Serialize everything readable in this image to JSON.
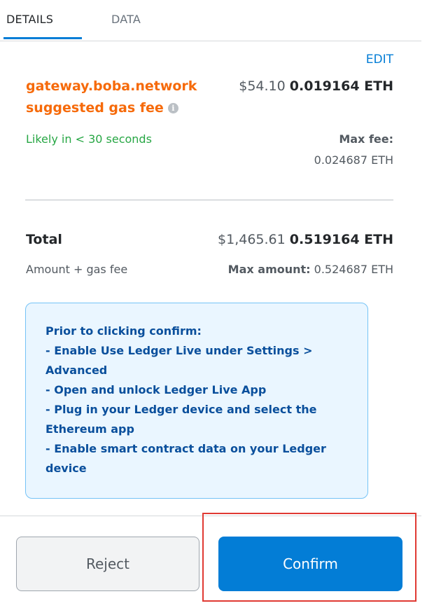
{
  "tabs": [
    {
      "label": "DETAILS",
      "active": true
    },
    {
      "label": "DATA",
      "active": false
    }
  ],
  "gas": {
    "edit_label": "EDIT",
    "site_line1": "gateway.boba.network",
    "site_line2": "suggested gas fee",
    "info_icon": "i",
    "fee_usd": "$54.10",
    "fee_eth": "0.019164 ETH",
    "likely": "Likely in < 30 seconds",
    "max_fee_label": "Max fee:",
    "max_fee_value": "0.024687 ETH"
  },
  "total": {
    "label": "Total",
    "usd": "$1,465.61",
    "eth": "0.519164 ETH",
    "sub_label": "Amount + gas fee",
    "max_amount_label": "Max amount:",
    "max_amount_value": "0.524687 ETH"
  },
  "notice": {
    "lines": [
      "Prior to clicking confirm:",
      "- Enable Use Ledger Live under Settings >",
      "Advanced",
      "- Open and unlock Ledger Live App",
      "- Plug in your Ledger device and select the",
      "Ethereum app",
      "- Enable smart contract data on your Ledger",
      "device"
    ]
  },
  "buttons": {
    "reject": "Reject",
    "confirm": "Confirm"
  },
  "colors": {
    "accent": "#037dd6",
    "site_orange": "#f66a0a",
    "success_green": "#28a745",
    "notice_bg": "#eaf6ff",
    "highlight_red": "#e03a33"
  }
}
